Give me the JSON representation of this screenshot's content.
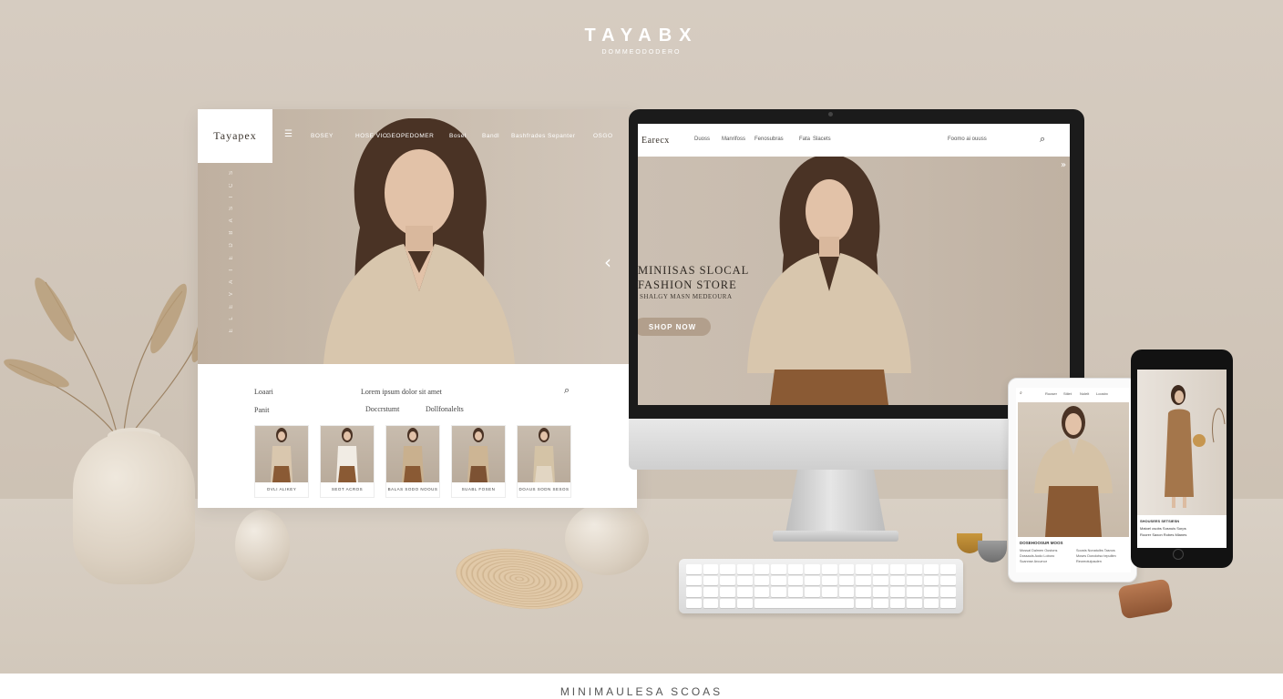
{
  "brand": {
    "name": "TAYABX",
    "tagline": "DOMMEODODERO"
  },
  "left_site": {
    "logo": "Tayapex",
    "menu_icon": "menu-icon",
    "nav": [
      "BOSEY",
      "HOSE VIC",
      "GEOPEDOMER",
      "Bosel",
      "Bandl",
      "Bashfrades",
      "Sepanter",
      "OSGO"
    ],
    "vertical_text": "E L E V A T E D   B A S I C S",
    "carousel_arrow": "‹",
    "labels": {
      "left1": "Loaari",
      "left2": "Panit",
      "center": "Lorem ipsum dolor sit amet",
      "sub1": "Doccrstumt",
      "sub2": "Dollfonalelts"
    },
    "search_icon": "search-icon",
    "products": [
      {
        "caption": "OVLI ALIKEY"
      },
      {
        "caption": "SEOT ACROS"
      },
      {
        "caption": "BALAS SODO NOOUS"
      },
      {
        "caption": "SUABL FOSEN"
      },
      {
        "caption": "DOAUS SODN SESOS"
      }
    ]
  },
  "desktop_site": {
    "logo": "Earecx",
    "nav": [
      "Duoss",
      "Manrifoss",
      "Fenosubras",
      "Fata",
      "Slacets"
    ],
    "search_text": "Foomo ai ouuss",
    "search_icon": "search-icon",
    "headline_1": "MINIISAS SLOCAL",
    "headline_2": "FASHION STORE",
    "subline": "SHALGY MASN MEDEOURA",
    "cta": "SHOP NOW",
    "next_icon": "»"
  },
  "tablet_site": {
    "bar": [
      "Rooser",
      "Stilet",
      "Nolelt",
      "Loosbx"
    ],
    "title": "DOSEHOOSUR MOOS",
    "col1": [
      "Mossal Dalmen Oustons",
      "Dossauls Aodo Loboro",
      "Scannse Arcumor"
    ],
    "col2": [
      "Soosts Nonatulbs Tasnos",
      "Moses Donolotso tepulitm",
      "Reoreotulpaulen"
    ]
  },
  "phone_site": {
    "title": "SHOUSEES SETSIESN",
    "lines": [
      "Matoel osobs Sosnuis Sorps",
      "Roorer Saxon Robes Mlanes"
    ]
  },
  "footer": {
    "text": "MINIMAULESA SCOAS"
  }
}
